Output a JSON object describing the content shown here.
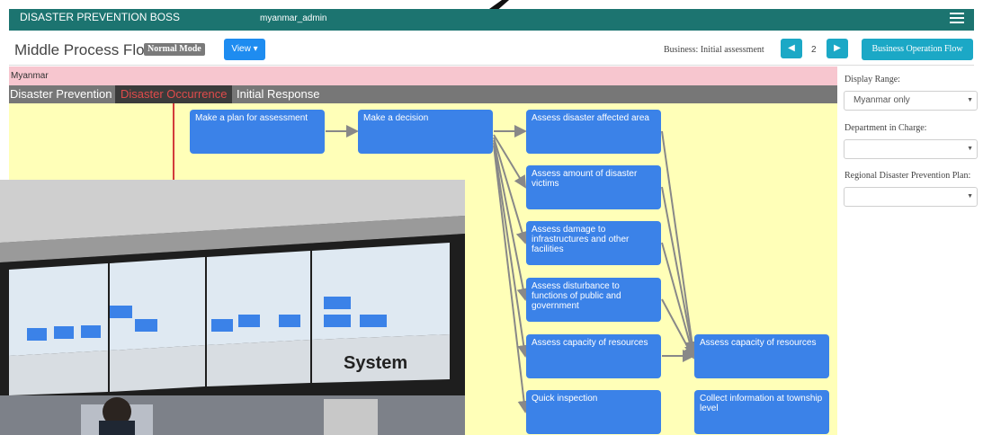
{
  "app": {
    "title": "DISASTER PREVENTION BOSS",
    "user": "myanmar_admin"
  },
  "header": {
    "title": "Middle Process Flow",
    "mode_badge": "Normal Mode",
    "view_button": "View ▾",
    "business_label": "Business: Initial assessment",
    "prev_symbol": "◀",
    "page": "2",
    "next_symbol": "▶",
    "flow_button": "Business Operation Flow"
  },
  "flow": {
    "region": "Myanmar",
    "phases": [
      "Disaster Prevention",
      "Disaster Occurrence",
      "Initial Response"
    ],
    "active_phase": "Disaster Occurrence",
    "nodes": [
      "Make a plan for assessment",
      "Make a decision",
      "Assess disaster affected area",
      "Assess amount of disaster victims",
      "Assess damage to infrastructures and other facilities",
      "Assess disturbance to functions of public and government",
      "Assess capacity of resources",
      "Quick inspection",
      "Assess capacity of resources",
      "Collect information at township level"
    ]
  },
  "sidebar": {
    "display_range_label": "Display Range:",
    "display_range_value": "Myanmar only",
    "department_label": "Department in Charge:",
    "department_value": "",
    "plan_label": "Regional Disaster Prevention Plan:",
    "plan_value": ""
  },
  "photo": {
    "caption": "System"
  },
  "colors": {
    "topbar": "#1c7470",
    "node": "#3b82e8",
    "canvas": "#ffffb8",
    "region": "#f7c6cf",
    "accent": "#1ba8c6"
  }
}
